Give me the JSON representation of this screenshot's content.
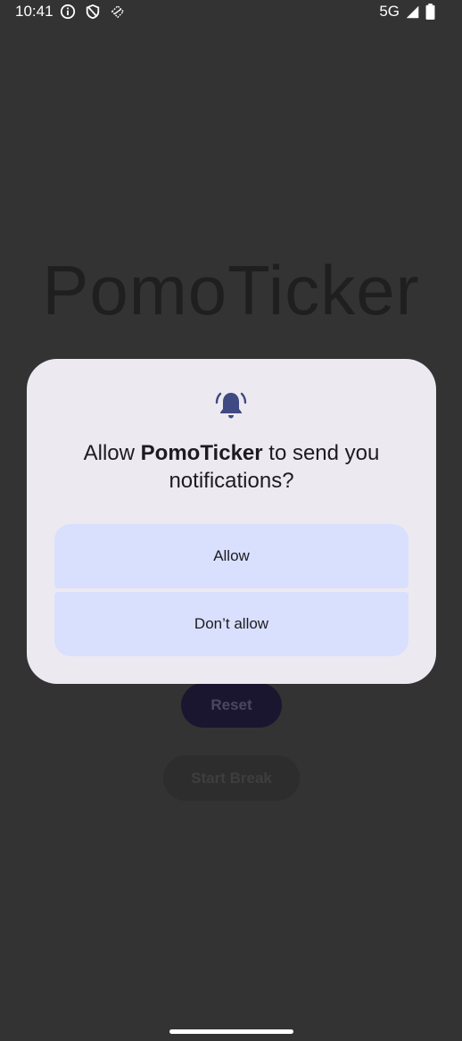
{
  "status_bar": {
    "time": "10:41",
    "network": "5G",
    "icons": [
      "info-icon",
      "vpn-shield-icon",
      "data-saver-icon",
      "signal-icon",
      "battery-icon"
    ]
  },
  "app": {
    "title": "PomoTicker",
    "reset_label": "Reset",
    "start_break_label": "Start Break"
  },
  "dialog": {
    "icon": "notification-bell-icon",
    "message_prefix": "Allow ",
    "app_name": "PomoTicker",
    "message_suffix": " to send you notifications?",
    "allow_label": "Allow",
    "deny_label": "Don’t allow",
    "accent_color": "#3f4a82",
    "button_color": "#d9e0fd",
    "background_color": "#ece9f1"
  }
}
